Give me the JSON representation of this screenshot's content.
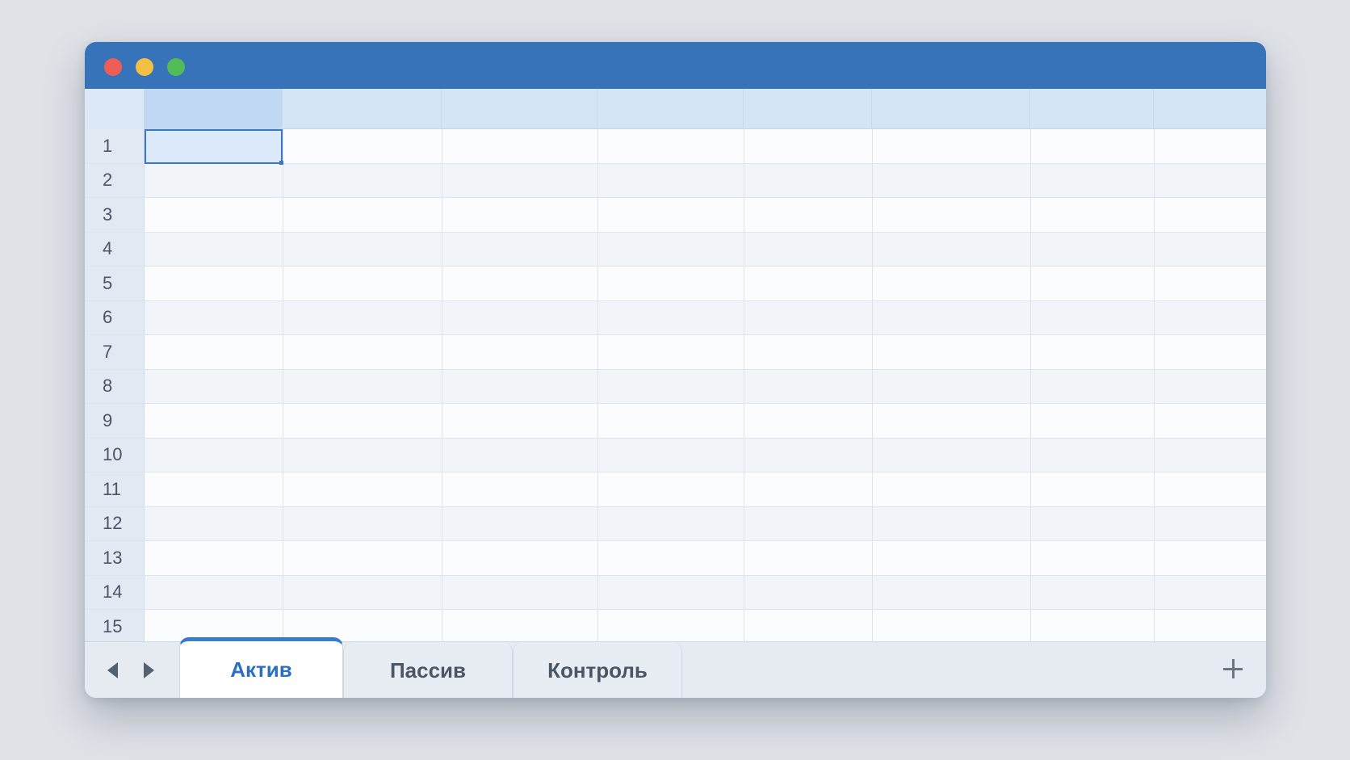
{
  "window": {
    "titlebar_color": "#3673b9",
    "traffic_lights": [
      "close",
      "minimize",
      "zoom"
    ]
  },
  "sheet": {
    "columns": [
      "",
      "",
      "",
      "",
      "",
      "",
      "",
      ""
    ],
    "rows": [
      "1",
      "2",
      "3",
      "4",
      "5",
      "6",
      "7",
      "8",
      "9",
      "10",
      "11",
      "12",
      "13",
      "14",
      "15"
    ],
    "active_cell": {
      "row": "1",
      "column_index": 1
    }
  },
  "tabs": [
    {
      "label": "Актив",
      "active": true
    },
    {
      "label": "Пассив",
      "active": false
    },
    {
      "label": "Контроль",
      "active": false
    }
  ],
  "tabbar": {
    "prev_icon": "triangle-left-icon",
    "next_icon": "triangle-right-icon",
    "add_icon": "plus-icon"
  },
  "colors": {
    "accent": "#3a7bd0",
    "header_bg": "#d6e5f6",
    "selected_header_bg": "#c0d8f3"
  }
}
